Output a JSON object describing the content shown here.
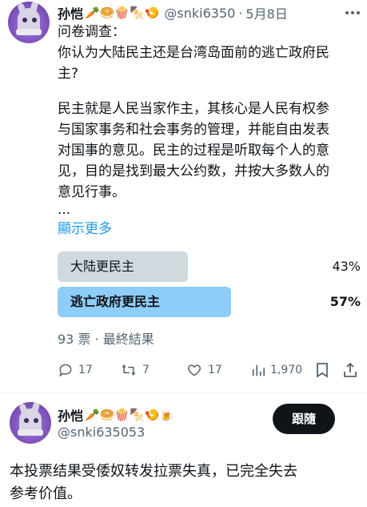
{
  "tweet": {
    "author_name": "孙恺",
    "author_emojis": "🥕🥯🍿🍢🍤",
    "handle": "@snki6350",
    "separator": "·",
    "date": "5月8日",
    "lines": [
      "问卷调查：",
      "你认为大陆民主还是台湾岛面前的逃亡政府民",
      "主?",
      "",
      "民主就是人民当家作主，其核心是人民有权参",
      "与国家事务和社会事务的管理，并能自由发表",
      "对国事的意见。民主的过程是听取每个人的意",
      "见，目的是找到最大公约数，并按大多数人的",
      "意见行事。",
      "..."
    ],
    "show_more": "顯示更多",
    "poll": {
      "options": [
        {
          "label": "大陆更民主",
          "percent_text": "43%",
          "fraction": 0.43,
          "color": "#cfd9de",
          "winner": false
        },
        {
          "label": "逃亡政府更民主",
          "percent_text": "57%",
          "fraction": 0.57,
          "color": "#8ecdf8",
          "winner": true
        }
      ],
      "summary": "93 票 · 最終結果"
    },
    "actions": {
      "reply_count": "17",
      "retweet_count": "7",
      "like_count": "17",
      "view_count": "1,970"
    }
  },
  "reply": {
    "author_name": "孙恺",
    "author_emojis": "🥕🥯🍿🍢🍤🍺",
    "handle": "@snki635053",
    "follow_label": "跟隨",
    "lines": [
      "本投票结果受倭奴转发拉票失真，已完全失去",
      "参考价值。"
    ]
  }
}
